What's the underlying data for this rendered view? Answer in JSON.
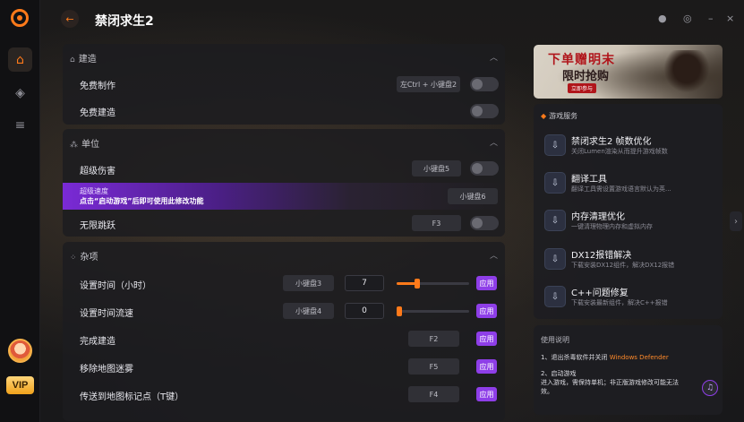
{
  "header": {
    "title": "禁闭求生2",
    "back_icon": "arrow-left-icon"
  },
  "rail": {
    "vip_label": "VIP"
  },
  "sections": {
    "build": {
      "title": "建造",
      "rows": [
        {
          "label": "免费制作",
          "key": "左Ctrl + 小键盘2"
        },
        {
          "label": "免费建造"
        }
      ]
    },
    "unit": {
      "title": "单位",
      "rows": [
        {
          "label": "超级伤害",
          "key": "小键盘5"
        },
        {
          "label": "超级速度",
          "note": "点击“启动游戏”后即可使用此修改功能",
          "key": "小键盘6"
        },
        {
          "label": "无限跳跃",
          "key": "F3"
        }
      ]
    },
    "misc": {
      "title": "杂项",
      "rows": [
        {
          "label": "设置时间（小时）",
          "key": "小键盘3",
          "value": "7",
          "slider_fraction": 0.28,
          "apply": "应用"
        },
        {
          "label": "设置时间流速",
          "key": "小键盘4",
          "value": "0",
          "slider_fraction": 0.0,
          "apply": "应用"
        },
        {
          "label": "完成建造",
          "key": "F2",
          "apply": "应用"
        },
        {
          "label": "移除地图迷雾",
          "key": "F5",
          "apply": "应用"
        },
        {
          "label": "传送到地图标记点（T键）",
          "key": "F4",
          "apply": "应用"
        }
      ]
    }
  },
  "banner": {
    "title": "下单赠明末",
    "subtitle": "限时抢购",
    "tag": "立即参与"
  },
  "services": {
    "title": "游戏服务",
    "items": [
      {
        "title": "禁闭求生2 帧数优化",
        "desc": "关闭Lumen渲染从而提升游戏帧数"
      },
      {
        "title": "翻译工具",
        "desc": "翻译工具需设置游戏语言默认为英..."
      },
      {
        "title": "内存清理优化",
        "desc": "一键清理物理内存和虚拟内存"
      },
      {
        "title": "DX12报错解决",
        "desc": "下载安装DX12组件，解决DX12报错"
      },
      {
        "title": "C++问题修复",
        "desc": "下载安装最新组件，解决C++报错"
      }
    ]
  },
  "usage": {
    "title": "使用说明",
    "step1_prefix": "1、退出杀毒软件并关闭",
    "step1_highlight": "Windows Defender",
    "step2_title": "2、启动游戏",
    "step2_text_a": "进入游戏，需保持单机；非正版游戏修改可能无法",
    "step2_text_b": "效。"
  },
  "colors": {
    "accent": "#ff7a1a",
    "apply_purple": "#8e3ee8",
    "highlight_row": "#7a2ad6"
  }
}
